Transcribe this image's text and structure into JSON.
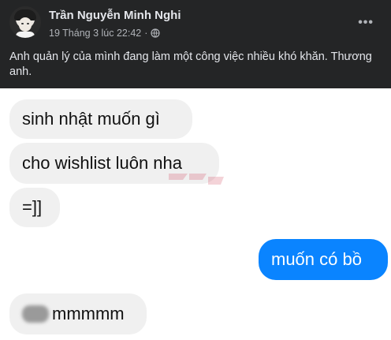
{
  "post": {
    "author": "Trần Nguyễn Minh Nghi",
    "timestamp": "19 Tháng 3 lúc 22:42",
    "separator": "·",
    "audience_icon": "globe-icon",
    "more_label": "•••",
    "caption": "Anh quản lý của mình đang làm một công việc nhiều khó khăn. Thương anh."
  },
  "chat": {
    "messages": [
      {
        "side": "incoming",
        "text": "sinh nhật muốn gì"
      },
      {
        "side": "incoming",
        "text": "cho wishlist luôn nha"
      },
      {
        "side": "incoming",
        "text": "=]]"
      },
      {
        "side": "outgoing",
        "text": "muốn có bồ"
      },
      {
        "side": "incoming",
        "text": "mmmmm"
      }
    ]
  },
  "colors": {
    "post_bg": "#242526",
    "chat_bg": "#ffffff",
    "incoming_bubble": "#f0f0f0",
    "outgoing_bubble": "#0a84ff"
  }
}
